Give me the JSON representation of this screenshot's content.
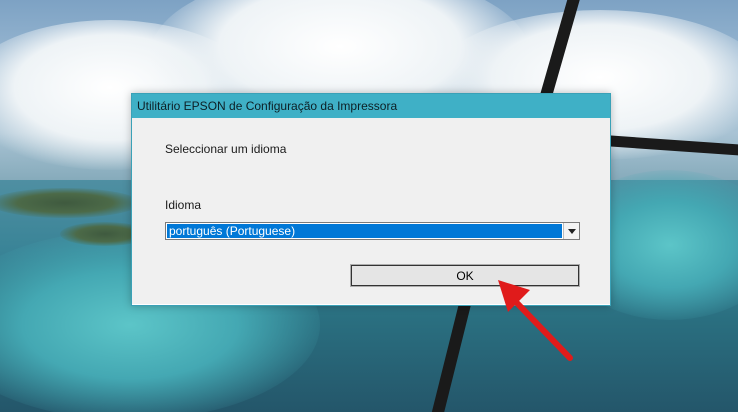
{
  "dialog": {
    "title": "Utilitário EPSON de Configuração da Impressora",
    "prompt": "Seleccionar um idioma",
    "language_label": "Idioma",
    "language_selected": "português (Portuguese)",
    "ok_label": "OK"
  },
  "icons": {
    "dropdown": "chevron-down-icon",
    "annotation": "red-arrow-icon"
  },
  "colors": {
    "titlebar": "#3fb0c6",
    "selection": "#0078d7",
    "annotation_arrow": "#e01b1b"
  }
}
